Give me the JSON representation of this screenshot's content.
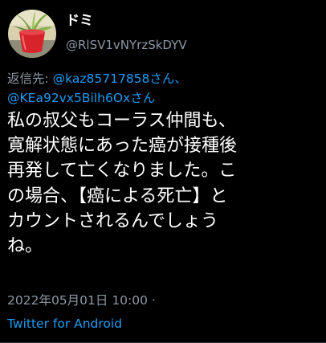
{
  "tweet": {
    "author": {
      "display_name": "ドミ",
      "handle": "@RlSV1vNYrzSkDYV"
    },
    "reply_context": {
      "prefix": "返信先:",
      "mention_1": "@kaz85717858",
      "suffix_1": "さん、",
      "mention_2": "@KEa92vx5Bilh6Ox",
      "suffix_2": "さん"
    },
    "text": "私の叔父もコーラス仲間も、\n寛解状態にあった癌が接種後\n再発して亡くなりました。こ\nの場合、【癌による死亡】と\nカウントされるんでしょう\nね。",
    "timestamp": "2022年05月01日 10:00 ·",
    "source_app": "Twitter for Android"
  },
  "colors": {
    "background": "#000000",
    "text_primary": "#ffffff",
    "text_secondary": "#8b98a5",
    "link": "#1d9bf0"
  },
  "icons": {
    "avatar": "potted-plant-avatar"
  }
}
